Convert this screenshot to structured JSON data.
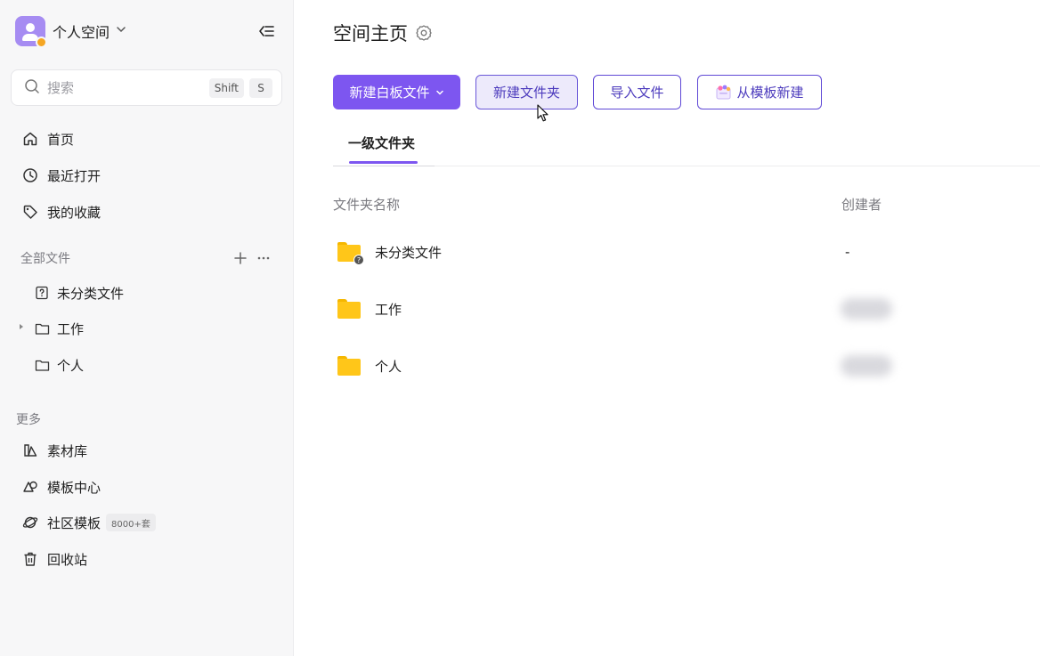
{
  "sidebar": {
    "workspace_name": "个人空间",
    "search": {
      "placeholder": "搜索",
      "shortcut_1": "Shift",
      "shortcut_2": "S"
    },
    "nav": [
      {
        "label": "首页",
        "icon": "home-icon"
      },
      {
        "label": "最近打开",
        "icon": "clock-icon"
      },
      {
        "label": "我的收藏",
        "icon": "tag-icon"
      }
    ],
    "files_section": {
      "title": "全部文件",
      "items": [
        {
          "label": "未分类文件",
          "icon": "unknown-file-icon"
        },
        {
          "label": "工作",
          "icon": "folder-icon",
          "expandable": true
        },
        {
          "label": "个人",
          "icon": "folder-icon"
        }
      ]
    },
    "more_section": {
      "title": "更多",
      "items": [
        {
          "label": "素材库",
          "icon": "material-library-icon"
        },
        {
          "label": "模板中心",
          "icon": "template-center-icon"
        },
        {
          "label": "社区模板",
          "icon": "planet-icon",
          "tag": "8000+套"
        },
        {
          "label": "回收站",
          "icon": "trash-icon"
        }
      ]
    }
  },
  "main": {
    "title": "空间主页",
    "buttons": {
      "new_board": "新建白板文件",
      "new_folder": "新建文件夹",
      "import": "导入文件",
      "from_template": "从模板新建"
    },
    "tab": "一级文件夹",
    "columns": {
      "name": "文件夹名称",
      "creator": "创建者"
    },
    "rows": [
      {
        "name": "未分类文件",
        "creator": "-"
      },
      {
        "name": "工作",
        "creator": ""
      },
      {
        "name": "个人",
        "creator": ""
      }
    ]
  },
  "colors": {
    "accent": "#7d56f0",
    "folder": "#ffc619"
  }
}
